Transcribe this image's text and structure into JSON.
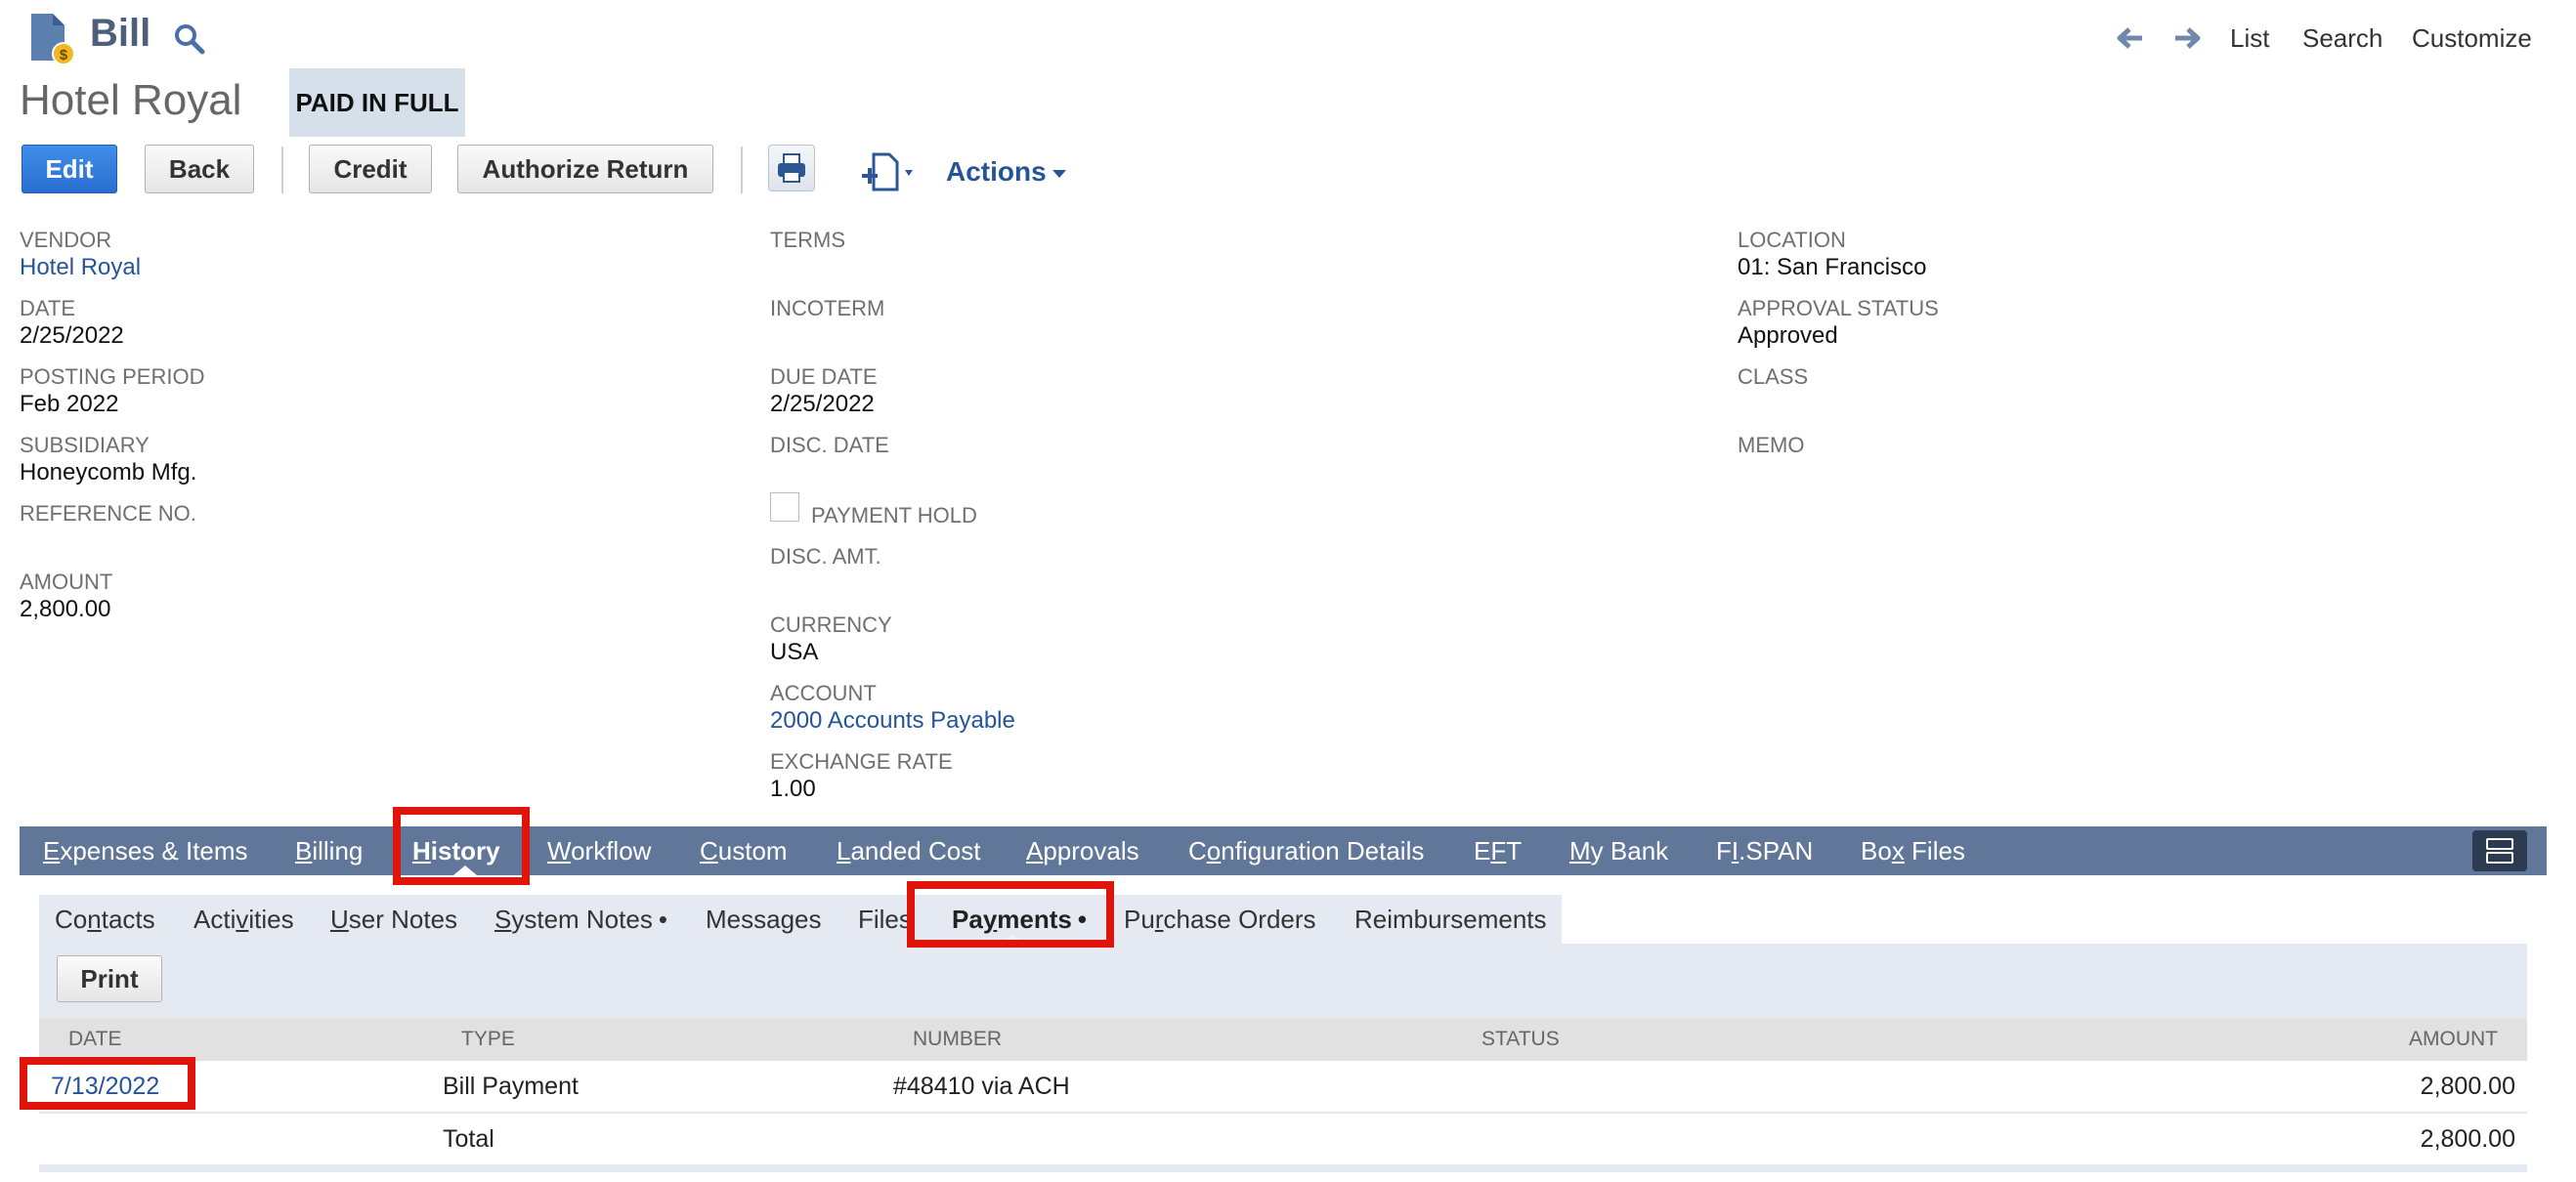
{
  "header": {
    "record_type": "Bill",
    "icons": {
      "record": "bill-document-icon",
      "search": "search-icon",
      "back": "arrow-left-icon",
      "forward": "arrow-right-icon"
    },
    "nav": {
      "list": "List",
      "search": "Search",
      "customize": "Customize"
    }
  },
  "title": "Hotel Royal",
  "status": "PAID IN FULL",
  "toolbar": {
    "edit": "Edit",
    "back": "Back",
    "credit": "Credit",
    "authorize_return": "Authorize Return",
    "actions": "Actions",
    "icons": {
      "print": "printer-icon",
      "new_document": "new-document-icon"
    }
  },
  "fields": {
    "vendor": {
      "label": "VENDOR",
      "value": "Hotel Royal"
    },
    "date": {
      "label": "DATE",
      "value": "2/25/2022"
    },
    "posting_period": {
      "label": "POSTING PERIOD",
      "value": "Feb 2022"
    },
    "subsidiary": {
      "label": "SUBSIDIARY",
      "value": "Honeycomb Mfg."
    },
    "reference_no": {
      "label": "REFERENCE NO.",
      "value": ""
    },
    "amount": {
      "label": "AMOUNT",
      "value": "2,800.00"
    },
    "terms": {
      "label": "TERMS",
      "value": ""
    },
    "incoterm": {
      "label": "INCOTERM",
      "value": ""
    },
    "due_date": {
      "label": "DUE DATE",
      "value": "2/25/2022"
    },
    "disc_date": {
      "label": "DISC. DATE",
      "value": ""
    },
    "payment_hold": {
      "label": "PAYMENT HOLD",
      "checked": false
    },
    "disc_amt": {
      "label": "DISC. AMT.",
      "value": ""
    },
    "currency": {
      "label": "CURRENCY",
      "value": "USA"
    },
    "account": {
      "label": "ACCOUNT",
      "value": "2000 Accounts Payable"
    },
    "exchange_rate": {
      "label": "EXCHANGE RATE",
      "value": "1.00"
    },
    "location": {
      "label": "LOCATION",
      "value": "01: San Francisco"
    },
    "approval_status": {
      "label": "APPROVAL STATUS",
      "value": "Approved"
    },
    "class": {
      "label": "CLASS",
      "value": ""
    },
    "memo": {
      "label": "MEMO",
      "value": ""
    }
  },
  "main_tabs": [
    {
      "pre": "",
      "u": "E",
      "post": "xpenses & Items"
    },
    {
      "pre": "",
      "u": "B",
      "post": "illing"
    },
    {
      "pre": "",
      "u": "H",
      "post": "istory",
      "active": true
    },
    {
      "pre": "",
      "u": "W",
      "post": "orkflow"
    },
    {
      "pre": "",
      "u": "C",
      "post": "ustom"
    },
    {
      "pre": "",
      "u": "L",
      "post": "anded Cost"
    },
    {
      "pre": "",
      "u": "A",
      "post": "pprovals"
    },
    {
      "pre": "C",
      "u": "o",
      "post": "nfiguration Details"
    },
    {
      "pre": "E",
      "u": "F",
      "post": "T"
    },
    {
      "pre": "",
      "u": "M",
      "post": "y Bank"
    },
    {
      "pre": "F",
      "u": "I",
      "post": ".SPAN"
    },
    {
      "pre": "Bo",
      "u": "x",
      "post": " Files"
    }
  ],
  "sub_tabs": [
    {
      "pre": "Co",
      "u": "n",
      "post": "tacts"
    },
    {
      "pre": "Acti",
      "u": "v",
      "post": "ities"
    },
    {
      "pre": "",
      "u": "U",
      "post": "ser Notes"
    },
    {
      "pre": "",
      "u": "S",
      "post": "ystem Notes",
      "dot": "•"
    },
    {
      "pre": "Messages",
      "u": "",
      "post": ""
    },
    {
      "pre": "Files",
      "u": "",
      "post": ""
    },
    {
      "pre": "Pa",
      "u": "y",
      "post": "ments",
      "dot": "•",
      "active": true
    },
    {
      "pre": "Pu",
      "u": "r",
      "post": "chase Orders"
    },
    {
      "pre": "Reimbursements",
      "u": "",
      "post": ""
    }
  ],
  "payments": {
    "print": "Print",
    "columns": {
      "date": "DATE",
      "type": "TYPE",
      "number": "NUMBER",
      "status": "STATUS",
      "amount": "AMOUNT"
    },
    "rows": [
      {
        "date": "7/13/2022",
        "type": "Bill Payment",
        "number": "#48410 via ACH",
        "status": "",
        "amount": "2,800.00"
      }
    ],
    "total": {
      "label": "Total",
      "amount": "2,800.00"
    }
  }
}
